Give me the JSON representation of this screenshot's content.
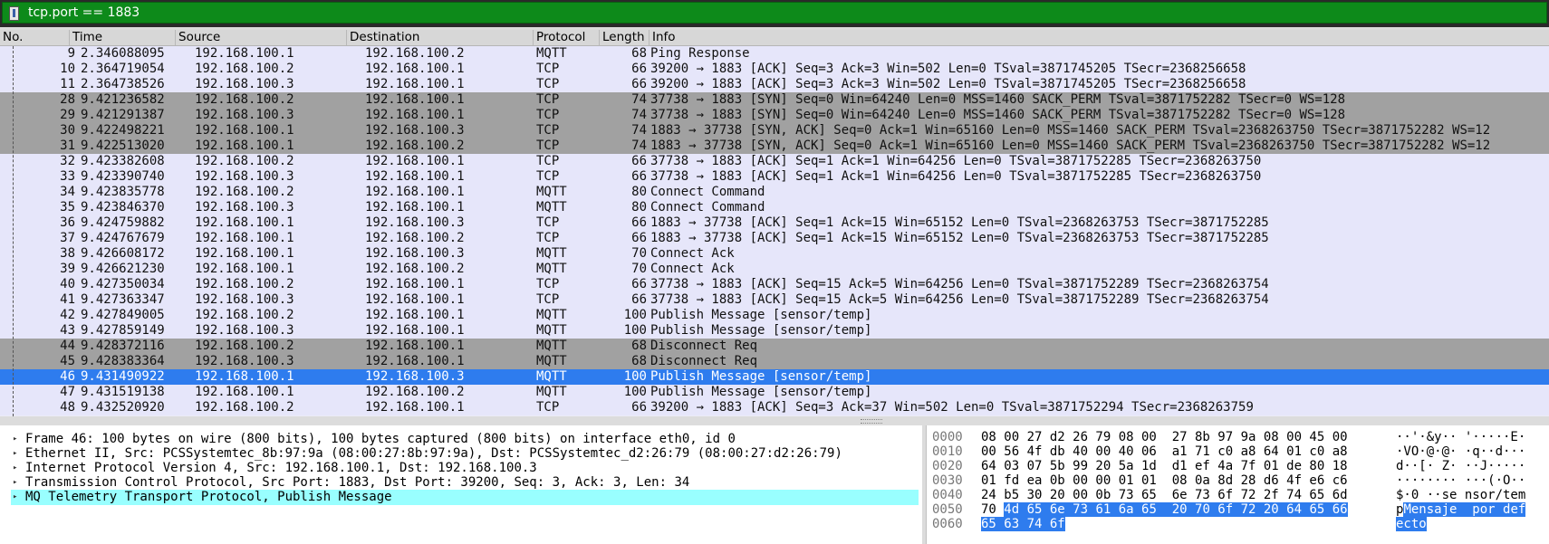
{
  "filter": {
    "bookmark_icon": "bookmark-icon",
    "expression": "tcp.port == 1883"
  },
  "columns": [
    "No.",
    "Time",
    "Source",
    "Destination",
    "Protocol",
    "Length",
    "Info"
  ],
  "packets": [
    {
      "no": "9",
      "time": "2.346088095",
      "src": "192.168.100.1",
      "dst": "192.168.100.2",
      "proto": "MQTT",
      "len": "68",
      "info": "Ping Response",
      "style": "mqtt"
    },
    {
      "no": "10",
      "time": "2.364719054",
      "src": "192.168.100.2",
      "dst": "192.168.100.1",
      "proto": "TCP",
      "len": "66",
      "info": "39200 → 1883 [ACK] Seq=3 Ack=3 Win=502 Len=0 TSval=3871745205 TSecr=2368256658",
      "style": "tcp"
    },
    {
      "no": "11",
      "time": "2.364738526",
      "src": "192.168.100.3",
      "dst": "192.168.100.1",
      "proto": "TCP",
      "len": "66",
      "info": "39200 → 1883 [ACK] Seq=3 Ack=3 Win=502 Len=0 TSval=3871745205 TSecr=2368256658",
      "style": "tcp"
    },
    {
      "no": "28",
      "time": "9.421236582",
      "src": "192.168.100.2",
      "dst": "192.168.100.1",
      "proto": "TCP",
      "len": "74",
      "info": "37738 → 1883 [SYN] Seq=0 Win=64240 Len=0 MSS=1460 SACK_PERM TSval=3871752282 TSecr=0 WS=128",
      "style": "syn"
    },
    {
      "no": "29",
      "time": "9.421291387",
      "src": "192.168.100.3",
      "dst": "192.168.100.1",
      "proto": "TCP",
      "len": "74",
      "info": "37738 → 1883 [SYN] Seq=0 Win=64240 Len=0 MSS=1460 SACK_PERM TSval=3871752282 TSecr=0 WS=128",
      "style": "syn"
    },
    {
      "no": "30",
      "time": "9.422498221",
      "src": "192.168.100.1",
      "dst": "192.168.100.3",
      "proto": "TCP",
      "len": "74",
      "info": "1883 → 37738 [SYN, ACK] Seq=0 Ack=1 Win=65160 Len=0 MSS=1460 SACK_PERM TSval=2368263750 TSecr=3871752282 WS=12",
      "style": "syn"
    },
    {
      "no": "31",
      "time": "9.422513020",
      "src": "192.168.100.1",
      "dst": "192.168.100.2",
      "proto": "TCP",
      "len": "74",
      "info": "1883 → 37738 [SYN, ACK] Seq=0 Ack=1 Win=65160 Len=0 MSS=1460 SACK_PERM TSval=2368263750 TSecr=3871752282 WS=12",
      "style": "syn"
    },
    {
      "no": "32",
      "time": "9.423382608",
      "src": "192.168.100.2",
      "dst": "192.168.100.1",
      "proto": "TCP",
      "len": "66",
      "info": "37738 → 1883 [ACK] Seq=1 Ack=1 Win=64256 Len=0 TSval=3871752285 TSecr=2368263750",
      "style": "tcp"
    },
    {
      "no": "33",
      "time": "9.423390740",
      "src": "192.168.100.3",
      "dst": "192.168.100.1",
      "proto": "TCP",
      "len": "66",
      "info": "37738 → 1883 [ACK] Seq=1 Ack=1 Win=64256 Len=0 TSval=3871752285 TSecr=2368263750",
      "style": "tcp"
    },
    {
      "no": "34",
      "time": "9.423835778",
      "src": "192.168.100.2",
      "dst": "192.168.100.1",
      "proto": "MQTT",
      "len": "80",
      "info": "Connect Command",
      "style": "mqtt"
    },
    {
      "no": "35",
      "time": "9.423846370",
      "src": "192.168.100.3",
      "dst": "192.168.100.1",
      "proto": "MQTT",
      "len": "80",
      "info": "Connect Command",
      "style": "mqtt"
    },
    {
      "no": "36",
      "time": "9.424759882",
      "src": "192.168.100.1",
      "dst": "192.168.100.3",
      "proto": "TCP",
      "len": "66",
      "info": "1883 → 37738 [ACK] Seq=1 Ack=15 Win=65152 Len=0 TSval=2368263753 TSecr=3871752285",
      "style": "tcp"
    },
    {
      "no": "37",
      "time": "9.424767679",
      "src": "192.168.100.1",
      "dst": "192.168.100.2",
      "proto": "TCP",
      "len": "66",
      "info": "1883 → 37738 [ACK] Seq=1 Ack=15 Win=65152 Len=0 TSval=2368263753 TSecr=3871752285",
      "style": "tcp"
    },
    {
      "no": "38",
      "time": "9.426608172",
      "src": "192.168.100.1",
      "dst": "192.168.100.3",
      "proto": "MQTT",
      "len": "70",
      "info": "Connect Ack",
      "style": "mqtt"
    },
    {
      "no": "39",
      "time": "9.426621230",
      "src": "192.168.100.1",
      "dst": "192.168.100.2",
      "proto": "MQTT",
      "len": "70",
      "info": "Connect Ack",
      "style": "mqtt"
    },
    {
      "no": "40",
      "time": "9.427350034",
      "src": "192.168.100.2",
      "dst": "192.168.100.1",
      "proto": "TCP",
      "len": "66",
      "info": "37738 → 1883 [ACK] Seq=15 Ack=5 Win=64256 Len=0 TSval=3871752289 TSecr=2368263754",
      "style": "tcp"
    },
    {
      "no": "41",
      "time": "9.427363347",
      "src": "192.168.100.3",
      "dst": "192.168.100.1",
      "proto": "TCP",
      "len": "66",
      "info": "37738 → 1883 [ACK] Seq=15 Ack=5 Win=64256 Len=0 TSval=3871752289 TSecr=2368263754",
      "style": "tcp"
    },
    {
      "no": "42",
      "time": "9.427849005",
      "src": "192.168.100.2",
      "dst": "192.168.100.1",
      "proto": "MQTT",
      "len": "100",
      "info": "Publish Message [sensor/temp]",
      "style": "mqtt"
    },
    {
      "no": "43",
      "time": "9.427859149",
      "src": "192.168.100.3",
      "dst": "192.168.100.1",
      "proto": "MQTT",
      "len": "100",
      "info": "Publish Message [sensor/temp]",
      "style": "mqtt"
    },
    {
      "no": "44",
      "time": "9.428372116",
      "src": "192.168.100.2",
      "dst": "192.168.100.1",
      "proto": "MQTT",
      "len": "68",
      "info": "Disconnect Req",
      "style": "syn"
    },
    {
      "no": "45",
      "time": "9.428383364",
      "src": "192.168.100.3",
      "dst": "192.168.100.1",
      "proto": "MQTT",
      "len": "68",
      "info": "Disconnect Req",
      "style": "syn"
    },
    {
      "no": "46",
      "time": "9.431490922",
      "src": "192.168.100.1",
      "dst": "192.168.100.3",
      "proto": "MQTT",
      "len": "100",
      "info": "Publish Message [sensor/temp]",
      "style": "sel"
    },
    {
      "no": "47",
      "time": "9.431519138",
      "src": "192.168.100.1",
      "dst": "192.168.100.2",
      "proto": "MQTT",
      "len": "100",
      "info": "Publish Message [sensor/temp]",
      "style": "mqtt"
    },
    {
      "no": "48",
      "time": "9.432520920",
      "src": "192.168.100.2",
      "dst": "192.168.100.1",
      "proto": "TCP",
      "len": "66",
      "info": "39200 → 1883 [ACK] Seq=3 Ack=37 Win=502 Len=0 TSval=3871752294 TSecr=2368263759",
      "style": "tcp"
    }
  ],
  "details": [
    {
      "text": "Frame 46: 100 bytes on wire (800 bits), 100 bytes captured (800 bits) on interface eth0, id 0",
      "selected": false
    },
    {
      "text": "Ethernet II, Src: PCSSystemtec_8b:97:9a (08:00:27:8b:97:9a), Dst: PCSSystemtec_d2:26:79 (08:00:27:d2:26:79)",
      "selected": false
    },
    {
      "text": "Internet Protocol Version 4, Src: 192.168.100.1, Dst: 192.168.100.3",
      "selected": false
    },
    {
      "text": "Transmission Control Protocol, Src Port: 1883, Dst Port: 39200, Seq: 3, Ack: 3, Len: 34",
      "selected": false
    },
    {
      "text": "MQ Telemetry Transport Protocol, Publish Message",
      "selected": true
    }
  ],
  "bytes": [
    {
      "offset": "0000",
      "hex": "08 00 27 d2 26 79 08 00  27 8b 97 9a 08 00 45 00",
      "hex_hl": "",
      "ascii": "··'·&y·· '·····E·",
      "ascii_hl": ""
    },
    {
      "offset": "0010",
      "hex": "00 56 4f db 40 00 40 06  a1 71 c0 a8 64 01 c0 a8",
      "hex_hl": "",
      "ascii": "·VO·@·@· ·q··d···",
      "ascii_hl": ""
    },
    {
      "offset": "0020",
      "hex": "64 03 07 5b 99 20 5a 1d  d1 ef 4a 7f 01 de 80 18",
      "hex_hl": "",
      "ascii": "d··[· Z· ··J·····",
      "ascii_hl": ""
    },
    {
      "offset": "0030",
      "hex": "01 fd ea 0b 00 00 01 01  08 0a 8d 28 d6 4f e6 c6",
      "hex_hl": "",
      "ascii": "········ ···(·O··",
      "ascii_hl": ""
    },
    {
      "offset": "0040",
      "hex": "24 b5 30 20 00 0b 73 65  6e 73 6f 72 2f 74 65 6d",
      "hex_hl": "",
      "ascii": "$·0 ··se nsor/tem",
      "ascii_hl": ""
    },
    {
      "offset": "0050",
      "hex": "70 ",
      "hex_hl": "4d 65 6e 73 61 6a 65  20 70 6f 72 20 64 65 66",
      "ascii": "p",
      "ascii_hl": "Mensaje  por def"
    },
    {
      "offset": "0060",
      "hex": "",
      "hex_hl": "65 63 74 6f",
      "ascii": "",
      "ascii_hl": "ecto"
    }
  ],
  "colors": {
    "filter_valid": "#0d8a1a",
    "row_default": "#e6e6fa",
    "row_syn_flag": "#a1a1a1",
    "row_selected": "#2e7cee",
    "detail_selected": "#99ffff"
  }
}
